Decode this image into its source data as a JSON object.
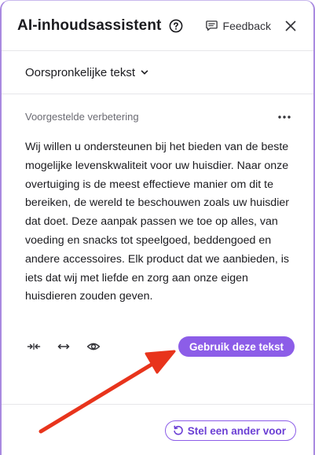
{
  "header": {
    "title": "AI-inhoudsassistent",
    "help_icon": "question-circle-icon",
    "feedback_label": "Feedback",
    "feedback_icon": "message-icon",
    "close_icon": "close-icon"
  },
  "section": {
    "selected": "Oorspronkelijke tekst",
    "icon": "chevron-down-icon"
  },
  "suggestion": {
    "label": "Voorgestelde verbetering",
    "more_icon": "more-horizontal-icon",
    "text": "Wij willen u ondersteunen bij het bieden van de beste mogelijke levenskwaliteit voor uw huisdier. Naar onze overtuiging is de meest effectieve manier om dit te bereiken, de wereld te beschouwen zoals uw huisdier dat doet. Deze aanpak passen we toe op alles, van voeding en snacks tot speelgoed, beddengoed en andere accessoires. Elk product dat we aanbieden, is iets dat wij met liefde en zorg aan onze eigen huisdieren zouden geven.",
    "tools": [
      "shorten-icon",
      "expand-icon",
      "preview-eye-icon"
    ],
    "use_button": "Gebruik deze tekst"
  },
  "footer": {
    "regenerate_button": "Stel een ander voor",
    "regenerate_icon": "refresh-icon"
  },
  "colors": {
    "accent": "#8c5de8",
    "panel_border": "#a98ae0",
    "annotation_arrow": "#e8341c"
  }
}
